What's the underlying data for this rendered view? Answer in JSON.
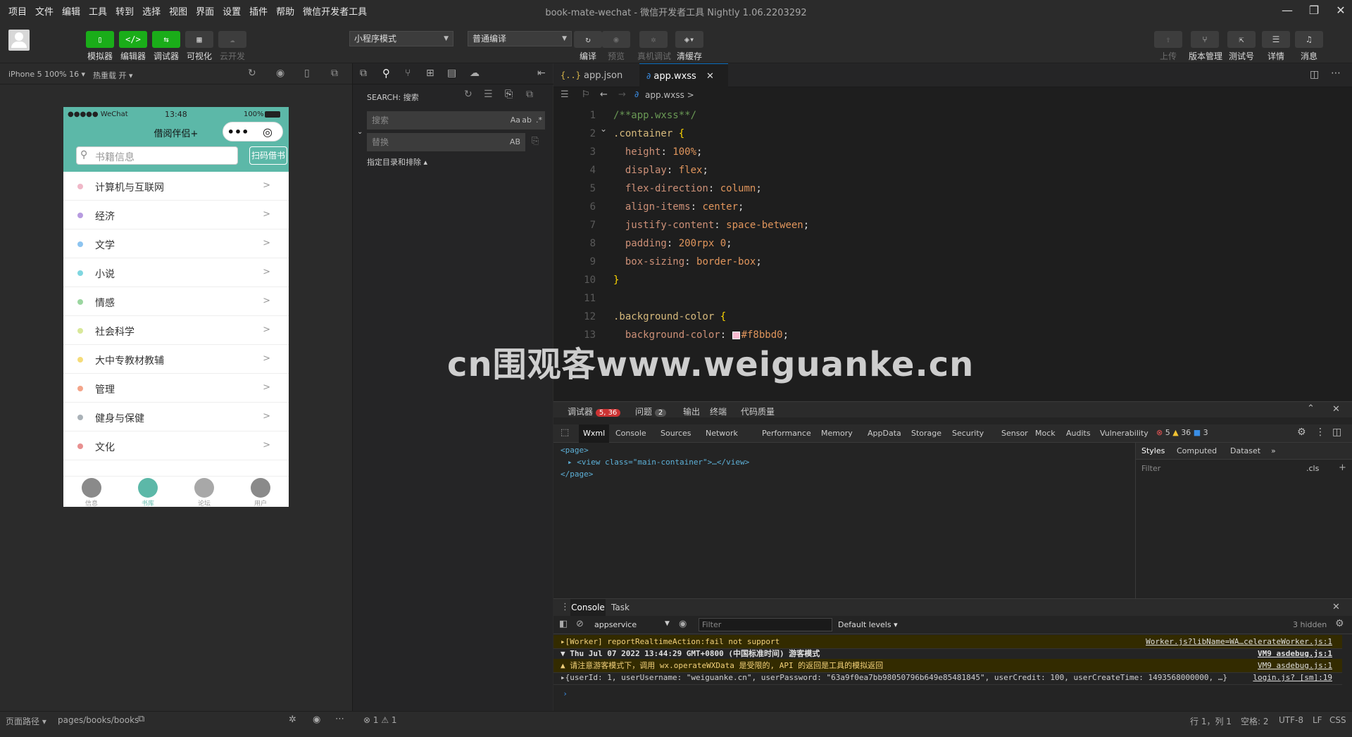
{
  "menu": [
    "项目",
    "文件",
    "编辑",
    "工具",
    "转到",
    "选择",
    "视图",
    "界面",
    "设置",
    "插件",
    "帮助",
    "微信开发者工具"
  ],
  "window_title": "book-mate-wechat - 微信开发者工具 Nightly 1.06.2203292",
  "toolbar": {
    "left_buttons": [
      {
        "label": "模拟器",
        "icon": "phone-icon"
      },
      {
        "label": "编辑器",
        "icon": "code-icon"
      },
      {
        "label": "调试器",
        "icon": "debug-icon"
      },
      {
        "label": "可视化",
        "icon": "visual-icon"
      },
      {
        "label": "云开发",
        "icon": "cloud-icon"
      }
    ],
    "mode_select": "小程序模式",
    "compile_select": "普通编译",
    "mid_buttons": [
      {
        "label": "编译"
      },
      {
        "label": "预览"
      },
      {
        "label": "真机调试"
      },
      {
        "label": "清缓存"
      }
    ],
    "right_buttons": [
      {
        "label": "上传"
      },
      {
        "label": "版本管理"
      },
      {
        "label": "测试号"
      },
      {
        "label": "详情"
      },
      {
        "label": "消息"
      }
    ]
  },
  "sim": {
    "device": "iPhone 5 100% 16 ▾",
    "hotreload": "热重载 开 ▾"
  },
  "phone": {
    "carrier": "●●●●● WeChat",
    "time": "13:48",
    "battery": "100%",
    "title": "借阅伴侣+",
    "search_placeholder": "书籍信息",
    "scan_button": "扫码借书",
    "categories": [
      {
        "name": "计算机与互联网",
        "color": "#f0b8c8"
      },
      {
        "name": "经济",
        "color": "#b79be0"
      },
      {
        "name": "文学",
        "color": "#8dc4f0"
      },
      {
        "name": "小说",
        "color": "#7fd6e0"
      },
      {
        "name": "情感",
        "color": "#9bd6a0"
      },
      {
        "name": "社会科学",
        "color": "#d8e89a"
      },
      {
        "name": "大中专教材教辅",
        "color": "#f5dc7a"
      },
      {
        "name": "管理",
        "color": "#f4a58a"
      },
      {
        "name": "健身与保健",
        "color": "#aab2b8"
      },
      {
        "name": "文化",
        "color": "#e89090"
      }
    ],
    "arrow": ">",
    "tabs": [
      "信息",
      "书库",
      "论坛",
      "用户"
    ]
  },
  "search_panel": {
    "title": "SEARCH: 搜索",
    "search_placeholder": "搜索",
    "replace_placeholder": "替换",
    "aa": "Aa",
    "ab": "AB",
    "filter_label": "指定目录和排除 ▴"
  },
  "editor": {
    "tabs": [
      {
        "label": "app.json",
        "icon": "{..}"
      },
      {
        "label": "app.wxss",
        "icon": "css"
      }
    ],
    "breadcrumb": "app.wxss >",
    "lines": [
      {
        "n": "1",
        "text": "/**app.wxss**/"
      },
      {
        "n": "2",
        "text": ".container {"
      },
      {
        "n": "3",
        "text": "  height: 100%;"
      },
      {
        "n": "4",
        "text": "  display: flex;"
      },
      {
        "n": "5",
        "text": "  flex-direction: column;"
      },
      {
        "n": "6",
        "text": "  align-items: center;"
      },
      {
        "n": "7",
        "text": "  justify-content: space-between;"
      },
      {
        "n": "8",
        "text": "  padding: 200rpx 0;"
      },
      {
        "n": "9",
        "text": "  box-sizing: border-box;"
      },
      {
        "n": "10",
        "text": "}"
      },
      {
        "n": "11",
        "text": ""
      },
      {
        "n": "12",
        "text": ".background-color {"
      },
      {
        "n": "13",
        "text": "  background-color: #f8bbd0;"
      }
    ],
    "swatch": "#f8bbd0"
  },
  "debugger": {
    "top_tabs": [
      {
        "label": "调试器",
        "badge": "5, 36"
      },
      {
        "label": "问题",
        "badge": "2"
      },
      {
        "label": "输出"
      },
      {
        "label": "终端"
      },
      {
        "label": "代码质量"
      }
    ],
    "dev_tabs": [
      "Wxml",
      "Console",
      "Sources",
      "Network",
      "Performance",
      "Memory",
      "AppData",
      "Storage",
      "Security",
      "Sensor",
      "Mock",
      "Audits",
      "Vulnerability"
    ],
    "counts": {
      "errors": "5",
      "warnings": "36",
      "info": "3"
    },
    "wxml": [
      "<page>",
      "<view class=\"main-container\">…</view>",
      "</page>"
    ],
    "style_tabs": [
      "Styles",
      "Computed",
      "Dataset",
      "»"
    ],
    "filter": "Filter",
    "cls": ".cls",
    "console_tabs": [
      "Console",
      "Task"
    ],
    "context": "appservice",
    "console_filter": "Filter",
    "levels": "Default levels ▾",
    "hidden": "3 hidden",
    "logs": [
      {
        "text": "▸[Worker] reportRealtimeAction:fail not support",
        "src": "Worker.js?libName=WA…celerateWorker.js:1",
        "type": "warn"
      },
      {
        "text": "▼ Thu Jul 07 2022 13:44:29 GMT+0800 (中国标准时间) 游客模式",
        "src": "VM9 asdebug.js:1",
        "type": "group"
      },
      {
        "text": "▲ 请注意游客模式下，调用 wx.operateWXData 是受限的, API 的返回是工具的模拟返回",
        "src": "VM9 asdebug.js:1",
        "type": "warn"
      },
      {
        "text": "▸{userId: 1, userUsername: \"weiguanke.cn\", userPassword: \"63a9f0ea7bb98050796b649e85481845\", userCredit: 100, userCreateTime: 1493568000000, …}",
        "src": "login.js? [sm]:19",
        "type": "log"
      }
    ]
  },
  "statusbar": {
    "path_label": "页面路径 ▾",
    "path": "pages/books/books",
    "problems": "⊗ 1 ⚠ 1",
    "position": "行 1，列 1",
    "spaces": "空格: 2",
    "encoding": "UTF-8",
    "eol": "LF",
    "lang": "CSS"
  },
  "watermark": "cn围观客www.weiguanke.cn"
}
